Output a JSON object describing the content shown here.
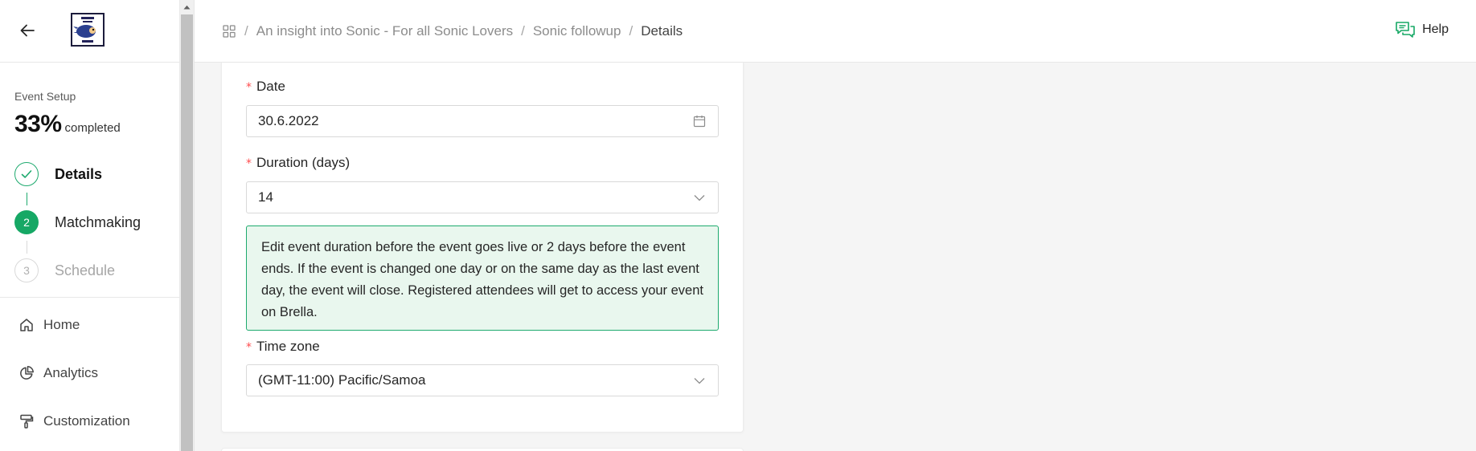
{
  "sidebar": {
    "section_label": "Event Setup",
    "progress": {
      "percent_text": "33%",
      "completed_word": "completed"
    },
    "steps": [
      {
        "number": "1",
        "label": "Details",
        "state": "done"
      },
      {
        "number": "2",
        "label": "Matchmaking",
        "state": "active"
      },
      {
        "number": "3",
        "label": "Schedule",
        "state": "pending"
      }
    ],
    "nav": [
      {
        "label": "Home",
        "icon": "home-icon"
      },
      {
        "label": "Analytics",
        "icon": "pie-chart-icon"
      },
      {
        "label": "Customization",
        "icon": "paint-roller-icon"
      }
    ]
  },
  "header": {
    "breadcrumb": [
      {
        "label": "An insight into Sonic - For all Sonic Lovers"
      },
      {
        "label": "Sonic followup"
      },
      {
        "label": "Details"
      }
    ],
    "separator": "/",
    "help_label": "Help"
  },
  "form": {
    "date": {
      "label": "Date",
      "value": "30.6.2022",
      "required_mark": "*"
    },
    "duration": {
      "label": "Duration (days)",
      "value": "14",
      "required_mark": "*"
    },
    "notice": "Edit event duration before the event goes live or 2 days before the event ends. If the event is changed one day or on the same day as the last event day, the event will close. Registered attendees will get to access your event on Brella.",
    "timezone": {
      "label": "Time zone",
      "value": "(GMT-11:00) Pacific/Samoa",
      "required_mark": "*"
    }
  },
  "colors": {
    "accent_green": "#16a865",
    "notice_bg": "#e9f7ee",
    "required_red": "#ff4d4f"
  }
}
